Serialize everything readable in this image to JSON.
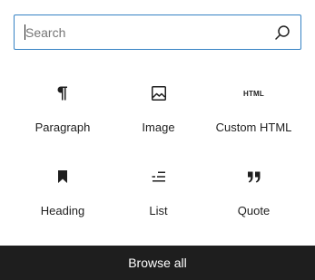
{
  "search": {
    "placeholder": "Search",
    "value": ""
  },
  "blocks": [
    {
      "label": "Paragraph",
      "icon": "paragraph-icon"
    },
    {
      "label": "Image",
      "icon": "image-icon"
    },
    {
      "label": "Custom HTML",
      "icon": "html-icon",
      "glyph": "HTML"
    },
    {
      "label": "Heading",
      "icon": "heading-bookmark-icon"
    },
    {
      "label": "List",
      "icon": "list-icon"
    },
    {
      "label": "Quote",
      "icon": "quote-icon"
    }
  ],
  "footer": {
    "browse_all_label": "Browse all"
  },
  "colors": {
    "focus_border": "#3582c4",
    "text": "#1e1e1e",
    "footer_bg": "#1e1e1e",
    "footer_text": "#ffffff"
  }
}
